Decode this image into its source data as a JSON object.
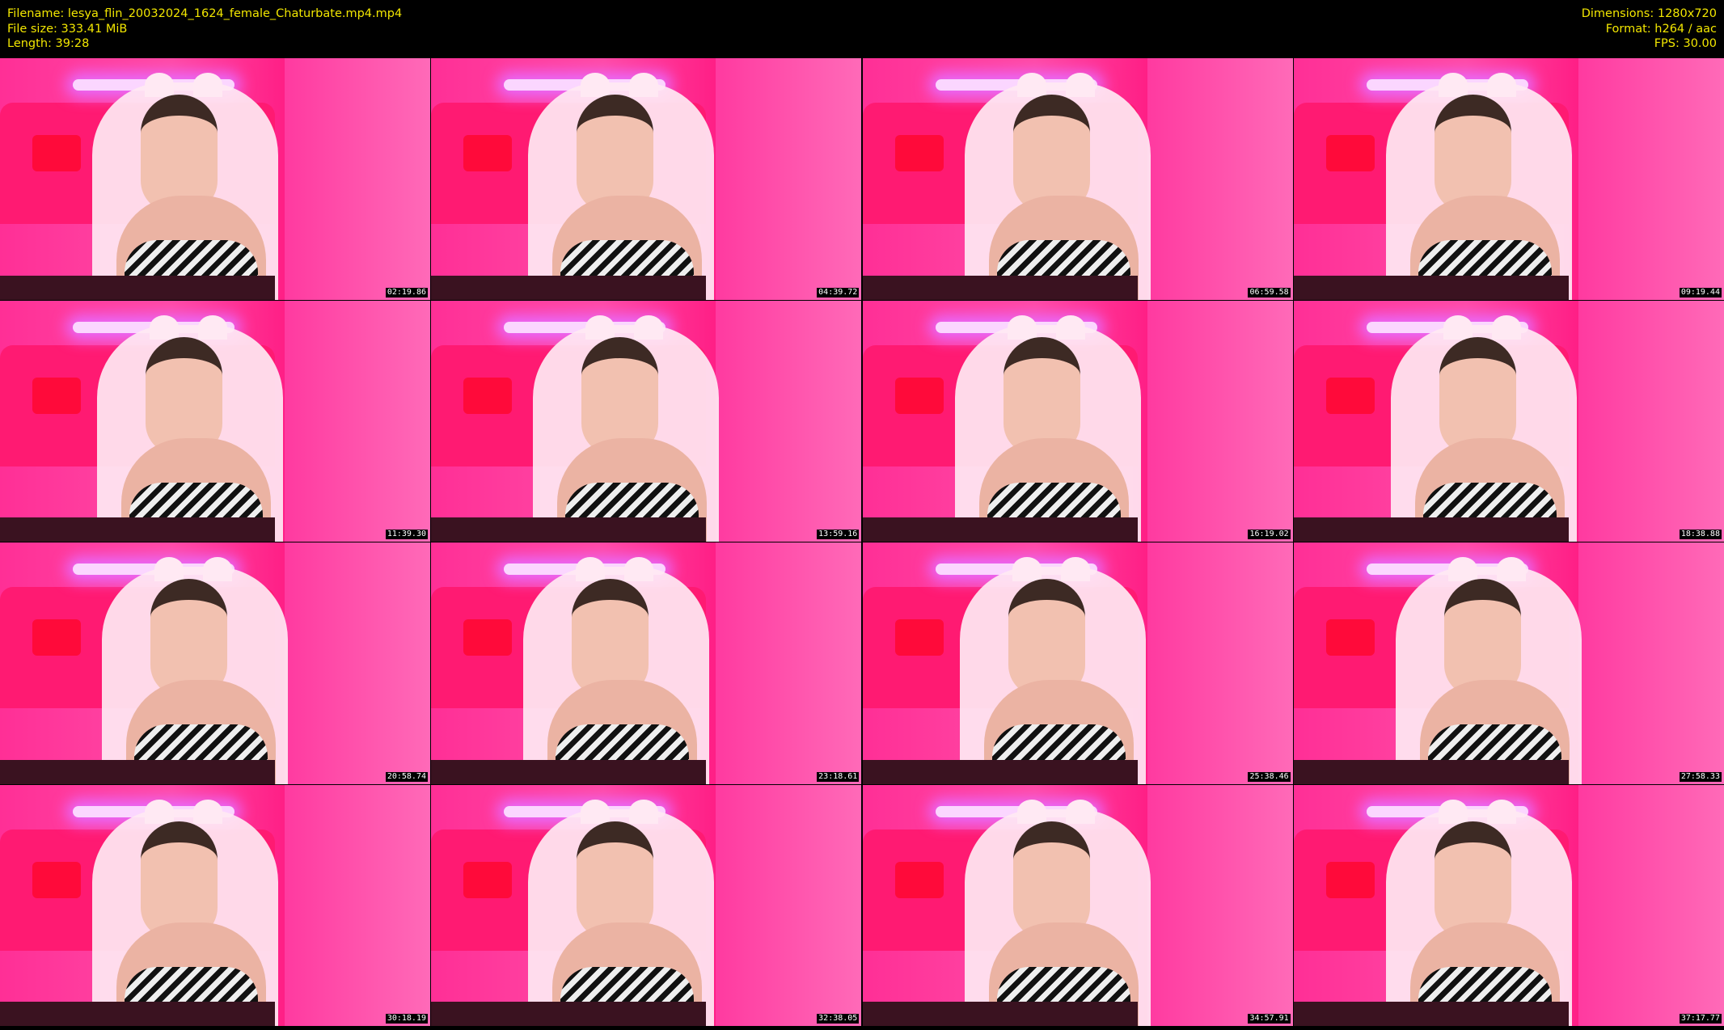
{
  "header": {
    "filename_line": "Filename: lesya_flin_20032024_1624_female_Chaturbate.mp4.mp4",
    "filesize_line": "File size: 333.41 MiB",
    "length_line": "Length: 39:28",
    "dimensions_line": "Dimensions: 1280x720",
    "format_line": "Format: h264 / aac",
    "fps_line": "FPS: 30.00"
  },
  "colors": {
    "header_text": "#f2e600",
    "background": "#000000",
    "timestamp_text": "#ffffff"
  },
  "thumbnails": [
    {
      "timestamp": "02:19.86"
    },
    {
      "timestamp": "04:39.72"
    },
    {
      "timestamp": "06:59.58"
    },
    {
      "timestamp": "09:19.44"
    },
    {
      "timestamp": "11:39.30"
    },
    {
      "timestamp": "13:59.16"
    },
    {
      "timestamp": "16:19.02"
    },
    {
      "timestamp": "18:38.88"
    },
    {
      "timestamp": "20:58.74"
    },
    {
      "timestamp": "23:18.61"
    },
    {
      "timestamp": "25:38.46"
    },
    {
      "timestamp": "27:58.33"
    },
    {
      "timestamp": "30:18.19"
    },
    {
      "timestamp": "32:38.05"
    },
    {
      "timestamp": "34:57.91"
    },
    {
      "timestamp": "37:17.77"
    }
  ]
}
